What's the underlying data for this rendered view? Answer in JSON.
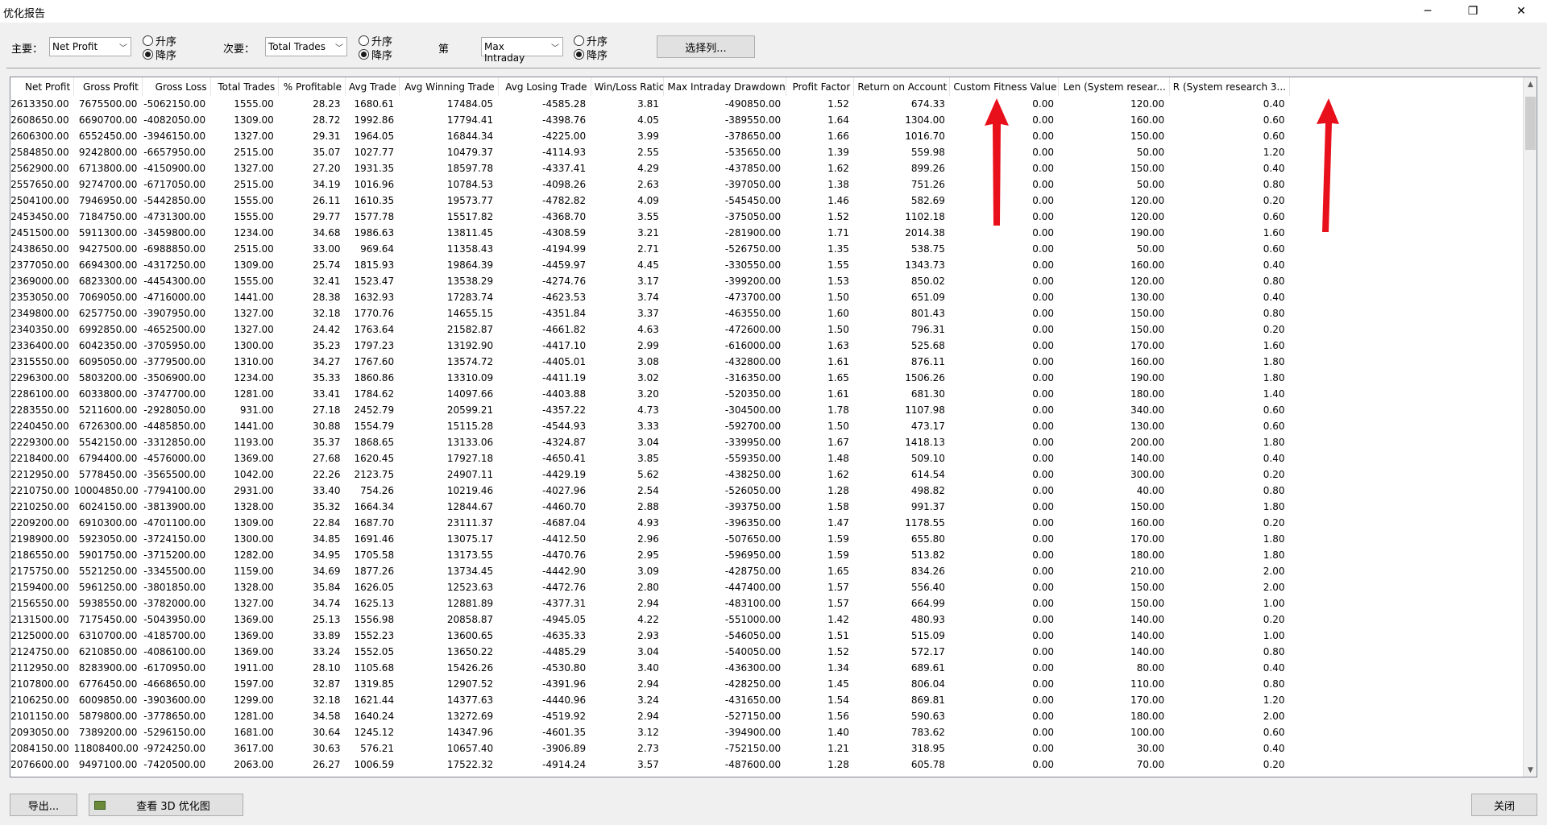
{
  "window": {
    "title": "优化报告",
    "minimize": "─",
    "restore": "❐",
    "close": "✕"
  },
  "toolbar": {
    "primary_label": "主要：",
    "primary_value": "Net Profit",
    "secondary_label": "次要：",
    "secondary_value": "Total Trades",
    "tertiary_label": "第",
    "tertiary_value": "Max Intraday",
    "asc": "升序",
    "desc": "降序",
    "select_columns": "选择列..."
  },
  "table": {
    "columns": [
      "Net Profit",
      "Gross Profit",
      "Gross Loss",
      "Total Trades",
      "% Profitable",
      "Avg Trade",
      "Avg Winning Trade",
      "Avg Losing Trade",
      "Win/Loss Ratio",
      "Max Intraday Drawdown",
      "Profit Factor",
      "Return on Account",
      "Custom Fitness Value",
      "Len (System resear...",
      "R (System research 3..."
    ],
    "rows": [
      [
        "2613350.00",
        "7675500.00",
        "-5062150.00",
        "1555.00",
        "28.23",
        "1680.61",
        "17484.05",
        "-4585.28",
        "3.81",
        "-490850.00",
        "1.52",
        "674.33",
        "0.00",
        "120.00",
        "0.40"
      ],
      [
        "2608650.00",
        "6690700.00",
        "-4082050.00",
        "1309.00",
        "28.72",
        "1992.86",
        "17794.41",
        "-4398.76",
        "4.05",
        "-389550.00",
        "1.64",
        "1304.00",
        "0.00",
        "160.00",
        "0.60"
      ],
      [
        "2606300.00",
        "6552450.00",
        "-3946150.00",
        "1327.00",
        "29.31",
        "1964.05",
        "16844.34",
        "-4225.00",
        "3.99",
        "-378650.00",
        "1.66",
        "1016.70",
        "0.00",
        "150.00",
        "0.60"
      ],
      [
        "2584850.00",
        "9242800.00",
        "-6657950.00",
        "2515.00",
        "35.07",
        "1027.77",
        "10479.37",
        "-4114.93",
        "2.55",
        "-535650.00",
        "1.39",
        "559.98",
        "0.00",
        "50.00",
        "1.20"
      ],
      [
        "2562900.00",
        "6713800.00",
        "-4150900.00",
        "1327.00",
        "27.20",
        "1931.35",
        "18597.78",
        "-4337.41",
        "4.29",
        "-437850.00",
        "1.62",
        "899.26",
        "0.00",
        "150.00",
        "0.40"
      ],
      [
        "2557650.00",
        "9274700.00",
        "-6717050.00",
        "2515.00",
        "34.19",
        "1016.96",
        "10784.53",
        "-4098.26",
        "2.63",
        "-397050.00",
        "1.38",
        "751.26",
        "0.00",
        "50.00",
        "0.80"
      ],
      [
        "2504100.00",
        "7946950.00",
        "-5442850.00",
        "1555.00",
        "26.11",
        "1610.35",
        "19573.77",
        "-4782.82",
        "4.09",
        "-545450.00",
        "1.46",
        "582.69",
        "0.00",
        "120.00",
        "0.20"
      ],
      [
        "2453450.00",
        "7184750.00",
        "-4731300.00",
        "1555.00",
        "29.77",
        "1577.78",
        "15517.82",
        "-4368.70",
        "3.55",
        "-375050.00",
        "1.52",
        "1102.18",
        "0.00",
        "120.00",
        "0.60"
      ],
      [
        "2451500.00",
        "5911300.00",
        "-3459800.00",
        "1234.00",
        "34.68",
        "1986.63",
        "13811.45",
        "-4308.59",
        "3.21",
        "-281900.00",
        "1.71",
        "2014.38",
        "0.00",
        "190.00",
        "1.60"
      ],
      [
        "2438650.00",
        "9427500.00",
        "-6988850.00",
        "2515.00",
        "33.00",
        "969.64",
        "11358.43",
        "-4194.99",
        "2.71",
        "-526750.00",
        "1.35",
        "538.75",
        "0.00",
        "50.00",
        "0.60"
      ],
      [
        "2377050.00",
        "6694300.00",
        "-4317250.00",
        "1309.00",
        "25.74",
        "1815.93",
        "19864.39",
        "-4459.97",
        "4.45",
        "-330550.00",
        "1.55",
        "1343.73",
        "0.00",
        "160.00",
        "0.40"
      ],
      [
        "2369000.00",
        "6823300.00",
        "-4454300.00",
        "1555.00",
        "32.41",
        "1523.47",
        "13538.29",
        "-4274.76",
        "3.17",
        "-399200.00",
        "1.53",
        "850.02",
        "0.00",
        "120.00",
        "0.80"
      ],
      [
        "2353050.00",
        "7069050.00",
        "-4716000.00",
        "1441.00",
        "28.38",
        "1632.93",
        "17283.74",
        "-4623.53",
        "3.74",
        "-473700.00",
        "1.50",
        "651.09",
        "0.00",
        "130.00",
        "0.40"
      ],
      [
        "2349800.00",
        "6257750.00",
        "-3907950.00",
        "1327.00",
        "32.18",
        "1770.76",
        "14655.15",
        "-4351.84",
        "3.37",
        "-463550.00",
        "1.60",
        "801.43",
        "0.00",
        "150.00",
        "0.80"
      ],
      [
        "2340350.00",
        "6992850.00",
        "-4652500.00",
        "1327.00",
        "24.42",
        "1763.64",
        "21582.87",
        "-4661.82",
        "4.63",
        "-472600.00",
        "1.50",
        "796.31",
        "0.00",
        "150.00",
        "0.20"
      ],
      [
        "2336400.00",
        "6042350.00",
        "-3705950.00",
        "1300.00",
        "35.23",
        "1797.23",
        "13192.90",
        "-4417.10",
        "2.99",
        "-616000.00",
        "1.63",
        "525.68",
        "0.00",
        "170.00",
        "1.60"
      ],
      [
        "2315550.00",
        "6095050.00",
        "-3779500.00",
        "1310.00",
        "34.27",
        "1767.60",
        "13574.72",
        "-4405.01",
        "3.08",
        "-432800.00",
        "1.61",
        "876.11",
        "0.00",
        "160.00",
        "1.80"
      ],
      [
        "2296300.00",
        "5803200.00",
        "-3506900.00",
        "1234.00",
        "35.33",
        "1860.86",
        "13310.09",
        "-4411.19",
        "3.02",
        "-316350.00",
        "1.65",
        "1506.26",
        "0.00",
        "190.00",
        "1.80"
      ],
      [
        "2286100.00",
        "6033800.00",
        "-3747700.00",
        "1281.00",
        "33.41",
        "1784.62",
        "14097.66",
        "-4403.88",
        "3.20",
        "-520350.00",
        "1.61",
        "681.30",
        "0.00",
        "180.00",
        "1.40"
      ],
      [
        "2283550.00",
        "5211600.00",
        "-2928050.00",
        "931.00",
        "27.18",
        "2452.79",
        "20599.21",
        "-4357.22",
        "4.73",
        "-304500.00",
        "1.78",
        "1107.98",
        "0.00",
        "340.00",
        "0.60"
      ],
      [
        "2240450.00",
        "6726300.00",
        "-4485850.00",
        "1441.00",
        "30.88",
        "1554.79",
        "15115.28",
        "-4544.93",
        "3.33",
        "-592700.00",
        "1.50",
        "473.17",
        "0.00",
        "130.00",
        "0.60"
      ],
      [
        "2229300.00",
        "5542150.00",
        "-3312850.00",
        "1193.00",
        "35.37",
        "1868.65",
        "13133.06",
        "-4324.87",
        "3.04",
        "-339950.00",
        "1.67",
        "1418.13",
        "0.00",
        "200.00",
        "1.80"
      ],
      [
        "2218400.00",
        "6794400.00",
        "-4576000.00",
        "1369.00",
        "27.68",
        "1620.45",
        "17927.18",
        "-4650.41",
        "3.85",
        "-559350.00",
        "1.48",
        "509.10",
        "0.00",
        "140.00",
        "0.40"
      ],
      [
        "2212950.00",
        "5778450.00",
        "-3565500.00",
        "1042.00",
        "22.26",
        "2123.75",
        "24907.11",
        "-4429.19",
        "5.62",
        "-438250.00",
        "1.62",
        "614.54",
        "0.00",
        "300.00",
        "0.20"
      ],
      [
        "2210750.00",
        "10004850.00",
        "-7794100.00",
        "2931.00",
        "33.40",
        "754.26",
        "10219.46",
        "-4027.96",
        "2.54",
        "-526050.00",
        "1.28",
        "498.82",
        "0.00",
        "40.00",
        "0.80"
      ],
      [
        "2210250.00",
        "6024150.00",
        "-3813900.00",
        "1328.00",
        "35.32",
        "1664.34",
        "12844.67",
        "-4460.70",
        "2.88",
        "-393750.00",
        "1.58",
        "991.37",
        "0.00",
        "150.00",
        "1.80"
      ],
      [
        "2209200.00",
        "6910300.00",
        "-4701100.00",
        "1309.00",
        "22.84",
        "1687.70",
        "23111.37",
        "-4687.04",
        "4.93",
        "-396350.00",
        "1.47",
        "1178.55",
        "0.00",
        "160.00",
        "0.20"
      ],
      [
        "2198900.00",
        "5923050.00",
        "-3724150.00",
        "1300.00",
        "34.85",
        "1691.46",
        "13075.17",
        "-4412.50",
        "2.96",
        "-507650.00",
        "1.59",
        "655.80",
        "0.00",
        "170.00",
        "1.80"
      ],
      [
        "2186550.00",
        "5901750.00",
        "-3715200.00",
        "1282.00",
        "34.95",
        "1705.58",
        "13173.55",
        "-4470.76",
        "2.95",
        "-596950.00",
        "1.59",
        "513.82",
        "0.00",
        "180.00",
        "1.80"
      ],
      [
        "2175750.00",
        "5521250.00",
        "-3345500.00",
        "1159.00",
        "34.69",
        "1877.26",
        "13734.45",
        "-4442.90",
        "3.09",
        "-428750.00",
        "1.65",
        "834.26",
        "0.00",
        "210.00",
        "2.00"
      ],
      [
        "2159400.00",
        "5961250.00",
        "-3801850.00",
        "1328.00",
        "35.84",
        "1626.05",
        "12523.63",
        "-4472.76",
        "2.80",
        "-447400.00",
        "1.57",
        "556.40",
        "0.00",
        "150.00",
        "2.00"
      ],
      [
        "2156550.00",
        "5938550.00",
        "-3782000.00",
        "1327.00",
        "34.74",
        "1625.13",
        "12881.89",
        "-4377.31",
        "2.94",
        "-483100.00",
        "1.57",
        "664.99",
        "0.00",
        "150.00",
        "1.00"
      ],
      [
        "2131500.00",
        "7175450.00",
        "-5043950.00",
        "1369.00",
        "25.13",
        "1556.98",
        "20858.87",
        "-4945.05",
        "4.22",
        "-551000.00",
        "1.42",
        "480.93",
        "0.00",
        "140.00",
        "0.20"
      ],
      [
        "2125000.00",
        "6310700.00",
        "-4185700.00",
        "1369.00",
        "33.89",
        "1552.23",
        "13600.65",
        "-4635.33",
        "2.93",
        "-546050.00",
        "1.51",
        "515.09",
        "0.00",
        "140.00",
        "1.00"
      ],
      [
        "2124750.00",
        "6210850.00",
        "-4086100.00",
        "1369.00",
        "33.24",
        "1552.05",
        "13650.22",
        "-4485.29",
        "3.04",
        "-540050.00",
        "1.52",
        "572.17",
        "0.00",
        "140.00",
        "0.80"
      ],
      [
        "2112950.00",
        "8283900.00",
        "-6170950.00",
        "1911.00",
        "28.10",
        "1105.68",
        "15426.26",
        "-4530.80",
        "3.40",
        "-436300.00",
        "1.34",
        "689.61",
        "0.00",
        "80.00",
        "0.40"
      ],
      [
        "2107800.00",
        "6776450.00",
        "-4668650.00",
        "1597.00",
        "32.87",
        "1319.85",
        "12907.52",
        "-4391.96",
        "2.94",
        "-428250.00",
        "1.45",
        "806.04",
        "0.00",
        "110.00",
        "0.80"
      ],
      [
        "2106250.00",
        "6009850.00",
        "-3903600.00",
        "1299.00",
        "32.18",
        "1621.44",
        "14377.63",
        "-4440.96",
        "3.24",
        "-431650.00",
        "1.54",
        "869.81",
        "0.00",
        "170.00",
        "1.20"
      ],
      [
        "2101150.00",
        "5879800.00",
        "-3778650.00",
        "1281.00",
        "34.58",
        "1640.24",
        "13272.69",
        "-4519.92",
        "2.94",
        "-527150.00",
        "1.56",
        "590.63",
        "0.00",
        "180.00",
        "2.00"
      ],
      [
        "2093050.00",
        "7389200.00",
        "-5296150.00",
        "1681.00",
        "30.64",
        "1245.12",
        "14347.96",
        "-4601.35",
        "3.12",
        "-394900.00",
        "1.40",
        "783.62",
        "0.00",
        "100.00",
        "0.60"
      ],
      [
        "2084150.00",
        "11808400.00",
        "-9724250.00",
        "3617.00",
        "30.63",
        "576.21",
        "10657.40",
        "-3906.89",
        "2.73",
        "-752150.00",
        "1.21",
        "318.95",
        "0.00",
        "30.00",
        "0.40"
      ],
      [
        "2076600.00",
        "9497100.00",
        "-7420500.00",
        "2063.00",
        "26.27",
        "1006.59",
        "17522.32",
        "-4914.24",
        "3.57",
        "-487600.00",
        "1.28",
        "605.78",
        "0.00",
        "70.00",
        "0.20"
      ]
    ]
  },
  "footer": {
    "export": "导出...",
    "view3d": "查看 3D 优化图",
    "close": "关闭"
  },
  "colors": {
    "annotation_arrow": "#e8101a"
  }
}
